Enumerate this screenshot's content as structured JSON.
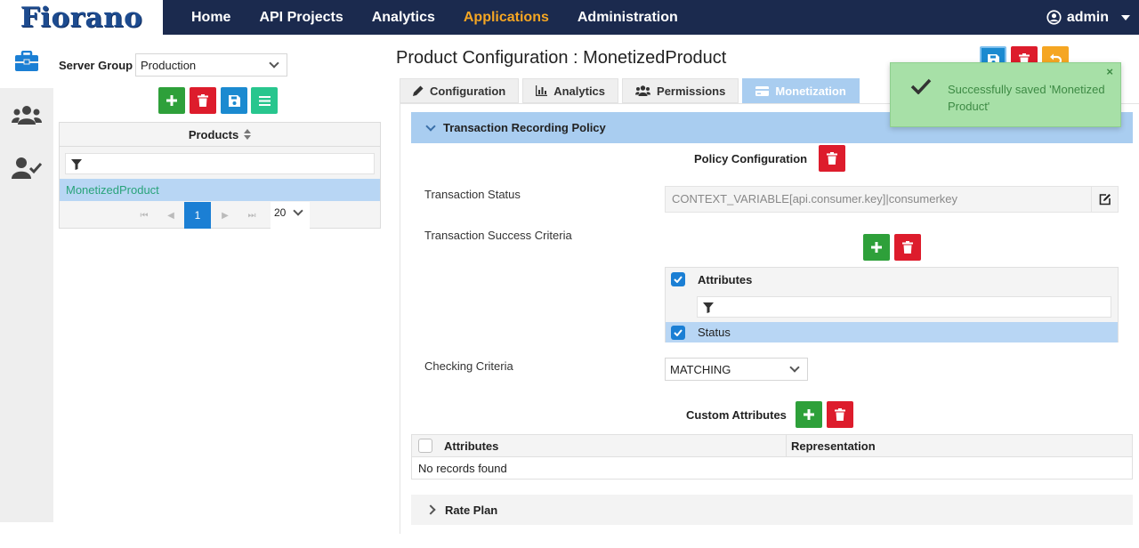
{
  "header": {
    "logo_text": "Fiorano",
    "nav": [
      "Home",
      "API Projects",
      "Analytics",
      "Applications",
      "Administration"
    ],
    "active_nav": "Applications",
    "user": "admin"
  },
  "sidebar": {
    "icons": [
      "briefcase-icon",
      "users-icon",
      "user-check-icon"
    ]
  },
  "products_panel": {
    "server_group_label": "Server Group",
    "server_group_value": "Production",
    "grid_header": "Products",
    "rows": [
      "MonetizedProduct"
    ],
    "current_page": "1",
    "page_size": "20"
  },
  "main": {
    "title": "Product Configuration : MonetizedProduct",
    "tabs": [
      "Configuration",
      "Analytics",
      "Permissions",
      "Monetization"
    ],
    "active_tab": "Monetization",
    "section_title": "Transaction Recording Policy",
    "policy_config_label": "Policy Configuration",
    "transaction_status_label": "Transaction Status",
    "transaction_status_value": "CONTEXT_VARIABLE[api.consumer.key]|consumerkey",
    "success_criteria_label": "Transaction Success Criteria",
    "attr_grid_header": "Attributes",
    "attr_rows": [
      "Status"
    ],
    "checking_criteria_label": "Checking Criteria",
    "checking_criteria_value": "MATCHING",
    "custom_attributes_label": "Custom Attributes",
    "custom_cols": [
      "Attributes",
      "Representation"
    ],
    "custom_empty": "No records found",
    "rate_plan_label": "Rate Plan"
  },
  "toast": {
    "message": "Successfully saved 'Monetized Product'",
    "close": "×"
  }
}
